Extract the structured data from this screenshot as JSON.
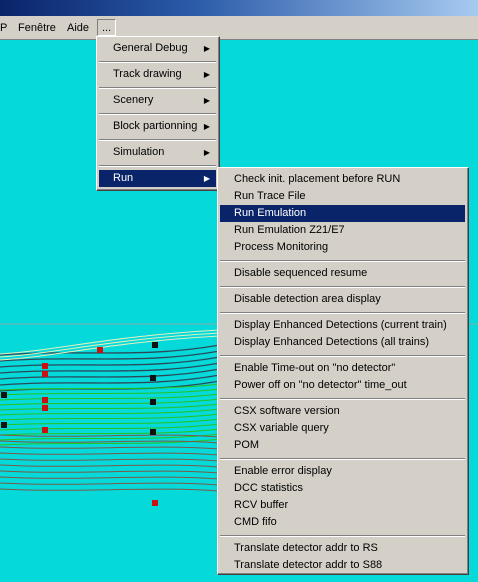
{
  "menubar": {
    "items": [
      {
        "label": "P"
      },
      {
        "label": "Fenêtre"
      },
      {
        "label": "Aide"
      },
      {
        "label": "..."
      }
    ]
  },
  "main_menu": {
    "items": [
      {
        "label": "General Debug"
      },
      {
        "label": "Track drawing"
      },
      {
        "label": "Scenery"
      },
      {
        "label": "Block partionning"
      },
      {
        "label": "Simulation"
      },
      {
        "label": "Run"
      }
    ]
  },
  "run_menu": {
    "groups": [
      [
        "Check init. placement before RUN",
        "Run Trace File",
        "Run Emulation",
        "Run Emulation Z21/E7",
        "Process Monitoring"
      ],
      [
        "Disable sequenced resume"
      ],
      [
        "Disable detection area display"
      ],
      [
        "Display Enhanced Detections (current train)",
        "Display Enhanced Detections (all trains)"
      ],
      [
        "Enable Time-out on \"no detector\"",
        "Power off on \"no detector\" time_out"
      ],
      [
        "CSX software version",
        "CSX variable query",
        "POM"
      ],
      [
        "Enable error display",
        "DCC statistics",
        "RCV buffer",
        "CMD fifo"
      ],
      [
        "Translate detector addr to RS",
        "Translate detector addr to S88"
      ]
    ],
    "selected": "Run Emulation"
  },
  "colors": {
    "canvas": "#05d9d9",
    "menu_bg": "#d4d0c8",
    "highlight": "#0a246a",
    "track_dark": "#2a4a5a",
    "track_green": "#22c522",
    "track_brown": "#7a5a4a",
    "marker": "#cc1111"
  }
}
